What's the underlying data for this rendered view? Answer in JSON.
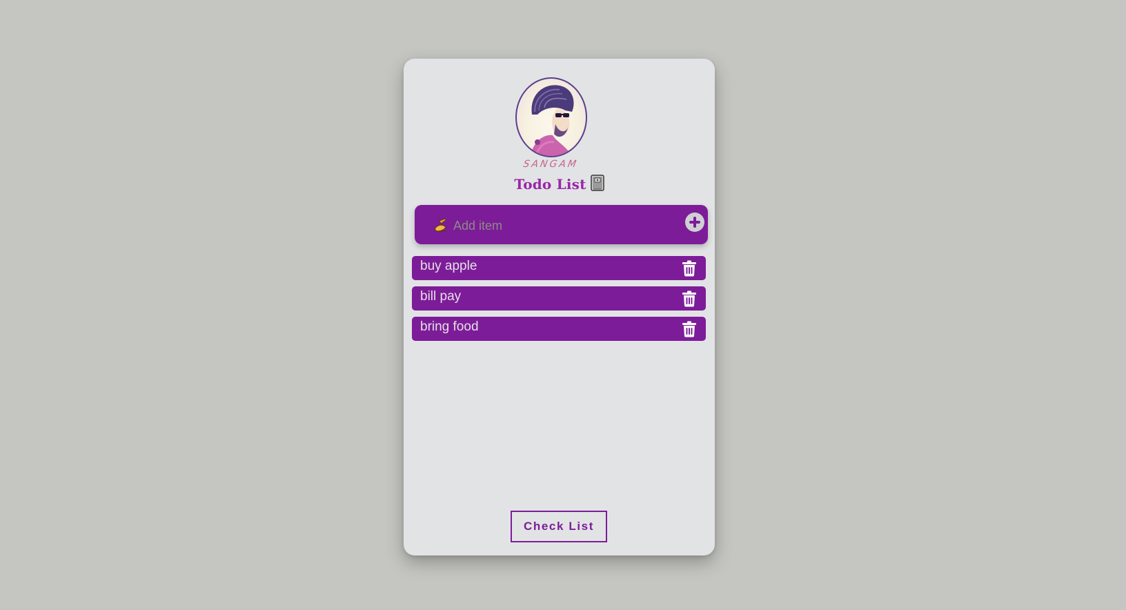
{
  "header": {
    "avatar_signature": "SANGAM",
    "title": "Todo List",
    "title_icon": "notebook-icon"
  },
  "add_item": {
    "icon": "writing-hand-icon",
    "placeholder": "Add item",
    "value": "",
    "add_button_icon": "plus-circle-icon"
  },
  "todos": [
    {
      "label": "buy apple",
      "delete_icon": "trash-icon"
    },
    {
      "label": "bill pay",
      "delete_icon": "trash-icon"
    },
    {
      "label": "bring food",
      "delete_icon": "trash-icon"
    }
  ],
  "footer": {
    "check_button_label": "Check List"
  },
  "colors": {
    "background": "#c5c6c1",
    "card": "#e2e3e5",
    "accent": "#7d1c98",
    "title": "#9a26a8"
  }
}
